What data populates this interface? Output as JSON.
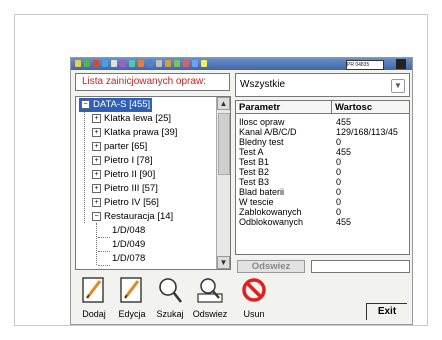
{
  "toolbar": {
    "field_text": "PR 04835",
    "icon_colors": [
      "#e8d04a",
      "#5ab04c",
      "#d04a3a",
      "#4aa0e0",
      "#e0e0e0",
      "#a060c0",
      "#60c0b0",
      "#e08040",
      "#5080d0",
      "#c0c0c0",
      "#d0a040",
      "#80c060",
      "#e06060",
      "#70a0f0",
      "#f0f060"
    ]
  },
  "left_panel": {
    "label": "Lista zainicjowanych opraw:",
    "tree": [
      {
        "label": "DATA-S [455]",
        "expander": "−",
        "level": 0,
        "selected": true
      },
      {
        "label": "Klatka lewa [25]",
        "expander": "+",
        "level": 1
      },
      {
        "label": "Klatka prawa [39]",
        "expander": "+",
        "level": 1
      },
      {
        "label": "parter [65]",
        "expander": "+",
        "level": 1
      },
      {
        "label": "Pietro I [78]",
        "expander": "+",
        "level": 1
      },
      {
        "label": "Pietro II [90]",
        "expander": "+",
        "level": 1
      },
      {
        "label": "Pietro III [57]",
        "expander": "+",
        "level": 1
      },
      {
        "label": "Pietro IV [56]",
        "expander": "+",
        "level": 1
      },
      {
        "label": "Restauracja [14]",
        "expander": "−",
        "level": 1
      },
      {
        "label": "1/D/048",
        "level": 2
      },
      {
        "label": "1/D/049",
        "level": 2
      },
      {
        "label": "1/D/078",
        "level": 2
      }
    ]
  },
  "right_panel": {
    "filter_value": "Wszystkie",
    "columns": [
      "Parametr",
      "Wartosc"
    ],
    "rows": [
      [
        "Ilosc opraw",
        "455"
      ],
      [
        "Kanal A/B/C/D",
        "129/168/113/45"
      ],
      [
        "Bledny test",
        "0"
      ],
      [
        "Test A",
        "455"
      ],
      [
        "Test B1",
        "0"
      ],
      [
        "Test B2",
        "0"
      ],
      [
        "Test B3",
        "0"
      ],
      [
        "Blad baterii",
        "0"
      ],
      [
        "W tescie",
        "0"
      ],
      [
        "Zablokowanych",
        "0"
      ],
      [
        "Odblokowanych",
        "455"
      ]
    ],
    "refresh_label": "Odswiez"
  },
  "bottom_bar": {
    "buttons": [
      {
        "label": "Dodaj",
        "icon": "pencil-icon"
      },
      {
        "label": "Edycja",
        "icon": "pencil-icon"
      },
      {
        "label": "Szukaj",
        "icon": "magnifier-icon"
      },
      {
        "label": "Odswiez",
        "icon": "magnifier-screen-icon"
      },
      {
        "label": "Usun",
        "icon": "no-sign-icon"
      }
    ],
    "exit_label": "Exit"
  }
}
